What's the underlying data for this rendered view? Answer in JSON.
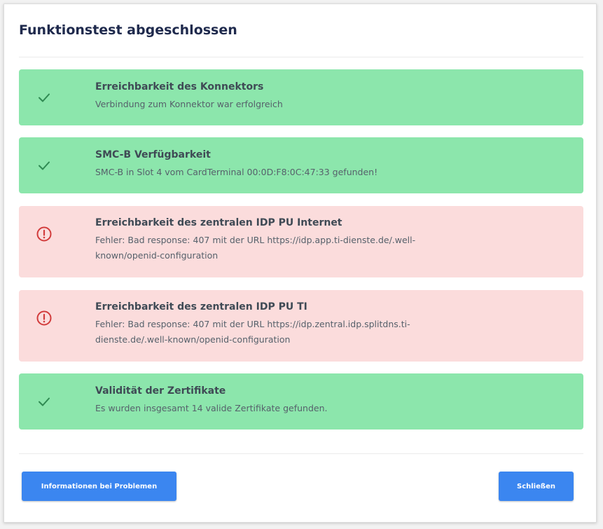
{
  "dialog": {
    "title": "Funktionstest abgeschlossen"
  },
  "results": [
    {
      "status": "success",
      "icon": "check-icon",
      "heading": "Erreichbarkeit des Konnektors",
      "detail": "Verbindung zum Konnektor war erfolgreich"
    },
    {
      "status": "success",
      "icon": "check-icon",
      "heading": "SMC-B Verfügbarkeit",
      "detail": "SMC-B in Slot 4 vom CardTerminal 00:0D:F8:0C:47:33 gefunden!"
    },
    {
      "status": "error",
      "icon": "error-circle-icon",
      "heading": "Erreichbarkeit des zentralen IDP PU Internet",
      "detail_line1": "Fehler: Bad response: 407 mit der URL https://idp.app.ti-dienste.de/.well-",
      "detail_line2": "known/openid-configuration"
    },
    {
      "status": "error",
      "icon": "error-circle-icon",
      "heading": "Erreichbarkeit des zentralen IDP PU TI",
      "detail_line1": "Fehler: Bad response: 407 mit der URL https://idp.zentral.idp.splitdns.ti-",
      "detail_line2": "dienste.de/.well-known/openid-configuration"
    },
    {
      "status": "success",
      "icon": "check-icon",
      "heading": "Validität der Zertifikate",
      "detail": "Es wurden insgesamt 14 valide Zertifikate gefunden."
    }
  ],
  "footer": {
    "info_button_label": "Informationen bei Problemen",
    "close_button_label": "Schließen"
  },
  "colors": {
    "success_background": "#8ce6ac",
    "error_background": "#fbdcdc",
    "success_icon": "#2f8a52",
    "error_icon": "#d23c3c",
    "button": "#3b86f0",
    "title": "#1f2a4d"
  }
}
